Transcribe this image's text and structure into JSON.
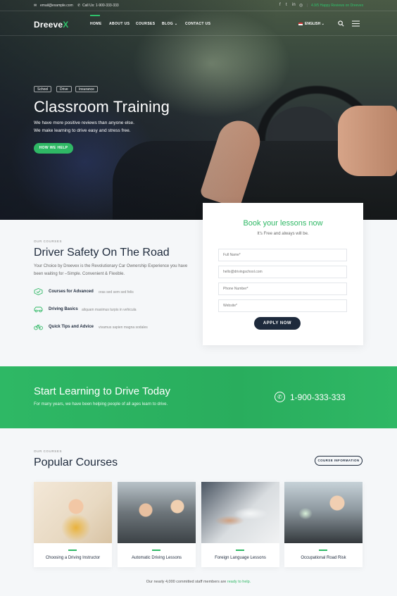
{
  "topbar": {
    "email": "email@example.com",
    "phone": "Call Us: 1-900-333-333",
    "social_icons": [
      "facebook-icon",
      "twitter-icon",
      "linkedin-icon",
      "instagram-icon"
    ],
    "reviews": "4.9/5 Happy Reviews on Dreevex"
  },
  "nav": {
    "logo": "Dreeve",
    "logo_x": "X",
    "items": [
      {
        "label": "HOME"
      },
      {
        "label": "ABOUT US"
      },
      {
        "label": "COURSES"
      },
      {
        "label": "BLOG ⌄"
      },
      {
        "label": "CONTACT US"
      }
    ],
    "language": "ENGLISH ⌄"
  },
  "hero": {
    "tags": [
      "School",
      "Drive",
      "Insurance"
    ],
    "title": "Classroom Training",
    "lines": [
      "We have more positive reviews than anyone else.",
      "We make learning to drive easy and stress free."
    ],
    "cta": "HOW WE HELP"
  },
  "booking": {
    "title": "Book your lessons now",
    "subtitle": "It’s Free and always will be.",
    "placeholders": {
      "name": "Full Name*",
      "email": "hello@drivingschool.com",
      "phone": "Phone Number*",
      "website": "Website*"
    },
    "submit": "APPLY NOW"
  },
  "safety": {
    "eyebrow": "OUR COURSES",
    "title": "Driver Safety On The Road",
    "body": "Your Choice by Dreevex is the Revolutionary Car Ownership Experience you have been waiting for –Simple. Convenient & Flexible.",
    "features": [
      {
        "name": "Courses for Advanced",
        "desc": "oras sed sem sed felis",
        "icon": "badge-icon"
      },
      {
        "name": "Driving Basics",
        "desc": "aliquam maximus turpis in vehicula",
        "icon": "car-icon"
      },
      {
        "name": "Quick Tips and Advice",
        "desc": "vivamus sapien magna sodales",
        "icon": "bicycle-icon"
      }
    ]
  },
  "band": {
    "title": "Start Learning to Drive Today",
    "subtitle": "For many years, we have been helping people of all ages learn to drive.",
    "phone": "1-900-333-333"
  },
  "courses": {
    "eyebrow": "OUR COURSES",
    "title": "Popular Courses",
    "button": "COURSE INFORMATION",
    "cards": [
      {
        "title": "Choosing a Driving Instructor"
      },
      {
        "title": "Automatic Driving Lessons"
      },
      {
        "title": "Foreign Language Lessons"
      },
      {
        "title": "Occupational Road Risk"
      }
    ],
    "note": "Our nearly 4,000 committed staff members are",
    "note_link": "ready to help."
  },
  "colors": {
    "brand_green": "#2fb865",
    "navy": "#1e2a3c"
  }
}
